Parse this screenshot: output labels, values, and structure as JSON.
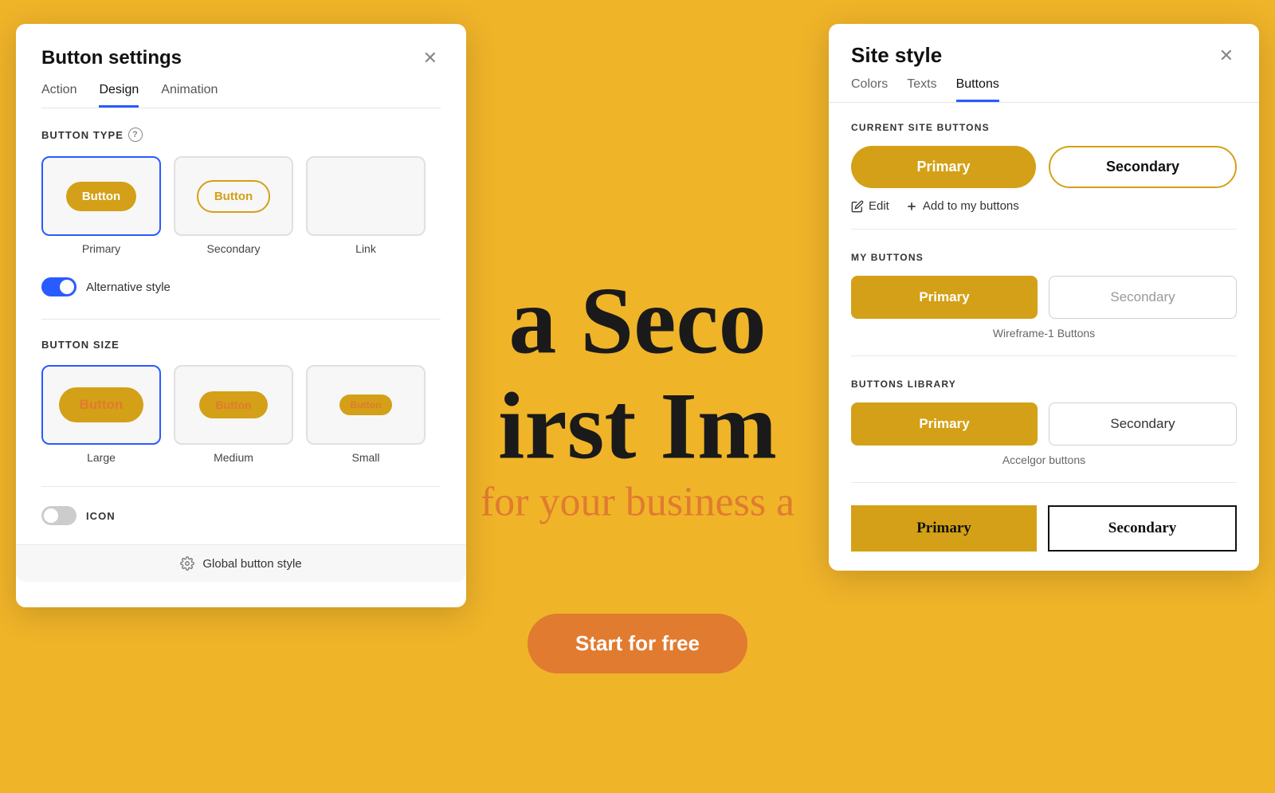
{
  "background": {
    "color": "#F0B429",
    "headline1": "a Seco",
    "headline2": "irst Im",
    "subtext": "for your business a",
    "cta_label": "Start for free"
  },
  "left_panel": {
    "title": "Button settings",
    "tabs": [
      "Action",
      "Design",
      "Animation"
    ],
    "active_tab": "Design",
    "section_button_type": "BUTTON TYPE",
    "button_types": [
      {
        "label": "Primary",
        "selected": true
      },
      {
        "label": "Secondary",
        "selected": false
      },
      {
        "label": "Link",
        "selected": false
      }
    ],
    "inner_btn_primary": "Button",
    "inner_btn_secondary": "Button",
    "alternative_style_label": "Alternative style",
    "alternative_style_on": true,
    "section_button_size": "BUTTON SIZE",
    "button_sizes": [
      {
        "label": "Large",
        "selected": true
      },
      {
        "label": "Medium",
        "selected": false
      },
      {
        "label": "Small",
        "selected": false
      }
    ],
    "inner_btn_lg": "Button",
    "inner_btn_md": "Button",
    "inner_btn_sm": "Button",
    "icon_label": "ICON",
    "icon_on": false,
    "global_btn_label": "Global button style"
  },
  "right_panel": {
    "title": "Site style",
    "tabs": [
      "Colors",
      "Texts",
      "Buttons"
    ],
    "active_tab": "Buttons",
    "section_current": "CURRENT SITE BUTTONS",
    "current_primary": "Primary",
    "current_secondary": "Secondary",
    "edit_label": "Edit",
    "add_label": "Add to my buttons",
    "section_my": "MY BUTTONS",
    "my_primary": "Primary",
    "my_secondary": "Secondary",
    "wireframe_name": "Wireframe-1 Buttons",
    "section_library": "BUTTONS LIBRARY",
    "lib_primary": "Primary",
    "lib_secondary": "Secondary",
    "accelgor_name": "Accelgor buttons",
    "serif_primary": "Primary",
    "serif_secondary": "Secondary"
  }
}
